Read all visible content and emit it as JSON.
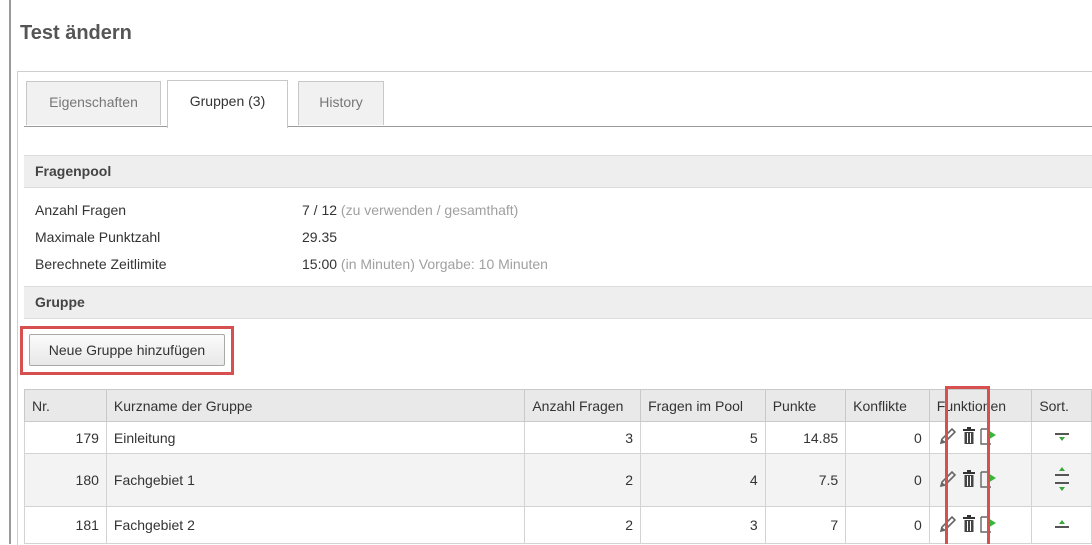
{
  "page": {
    "title": "Test ändern"
  },
  "tabs": [
    {
      "label": "Eigenschaften",
      "active": false
    },
    {
      "label": "Gruppen (3)",
      "active": true
    },
    {
      "label": "History",
      "active": false
    }
  ],
  "fragenpool": {
    "header": "Fragenpool",
    "rows": [
      {
        "label": "Anzahl Fragen",
        "value": "7 / 12",
        "note": " (zu verwenden / gesamthaft)",
        "extra": ""
      },
      {
        "label": "Maximale Punktzahl",
        "value": "29.35",
        "note": "",
        "extra": ""
      },
      {
        "label": "Berechnete Zeitlimite",
        "value": "15:00",
        "note": " (in Minuten)",
        "extra": " Vorgabe: 10 Minuten"
      }
    ]
  },
  "gruppe": {
    "header": "Gruppe",
    "add_button": "Neue Gruppe hinzufügen",
    "columns": [
      "Nr.",
      "Kurzname der Gruppe",
      "Anzahl Fragen",
      "Fragen im Pool",
      "Punkte",
      "Konflikte",
      "Funktionen",
      "Sort."
    ],
    "rows": [
      {
        "nr": "179",
        "name": "Einleitung",
        "anzahl": "3",
        "pool": "5",
        "punkte": "14.85",
        "konflikte": "0",
        "sort": "down"
      },
      {
        "nr": "180",
        "name": "Fachgebiet 1",
        "anzahl": "2",
        "pool": "4",
        "punkte": "7.5",
        "konflikte": "0",
        "sort": "both"
      },
      {
        "nr": "181",
        "name": "Fachgebiet 2",
        "anzahl": "2",
        "pool": "3",
        "punkte": "7",
        "konflikte": "0",
        "sort": "up"
      }
    ]
  },
  "colors": {
    "highlight": "#d65050",
    "sort_arrow": "#3aa63a",
    "export_arrow": "#3ab53a"
  },
  "icons": [
    "pencil-icon",
    "trash-icon",
    "export-icon",
    "sort-down-icon",
    "sort-up-icon"
  ]
}
